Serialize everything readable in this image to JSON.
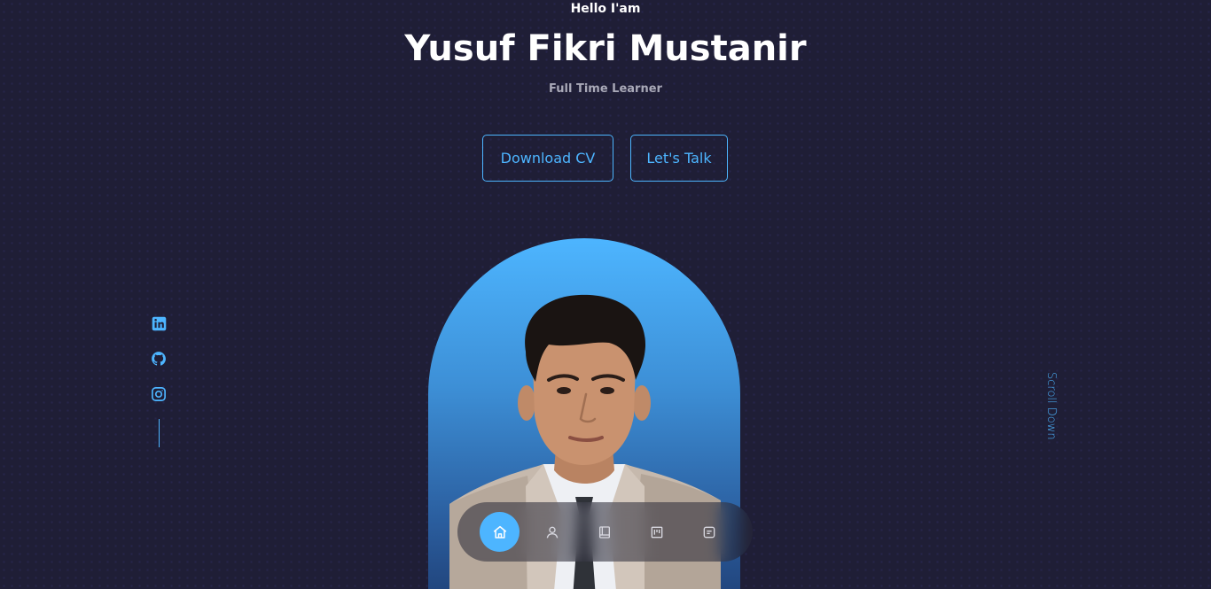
{
  "hero": {
    "greeting": "Hello I'am",
    "name": "Yusuf Fikri Mustanir",
    "subtitle": "Full Time Learner"
  },
  "cta": {
    "download_cv_label": "Download CV",
    "lets_talk_label": "Let's Talk"
  },
  "socials": [
    {
      "icon": "linkedin-icon"
    },
    {
      "icon": "github-icon"
    },
    {
      "icon": "instagram-icon"
    }
  ],
  "scroll_down_label": "Scroll Down",
  "navbar": {
    "items": [
      {
        "icon": "home-icon",
        "active": true
      },
      {
        "icon": "user-icon",
        "active": false
      },
      {
        "icon": "book-icon",
        "active": false
      },
      {
        "icon": "portfolio-icon",
        "active": false
      },
      {
        "icon": "message-icon",
        "active": false
      }
    ]
  },
  "colors": {
    "background": "#1f1e36",
    "accent": "#4db5ff",
    "text_primary": "#ffffff",
    "text_muted": "#a9a9b8"
  }
}
